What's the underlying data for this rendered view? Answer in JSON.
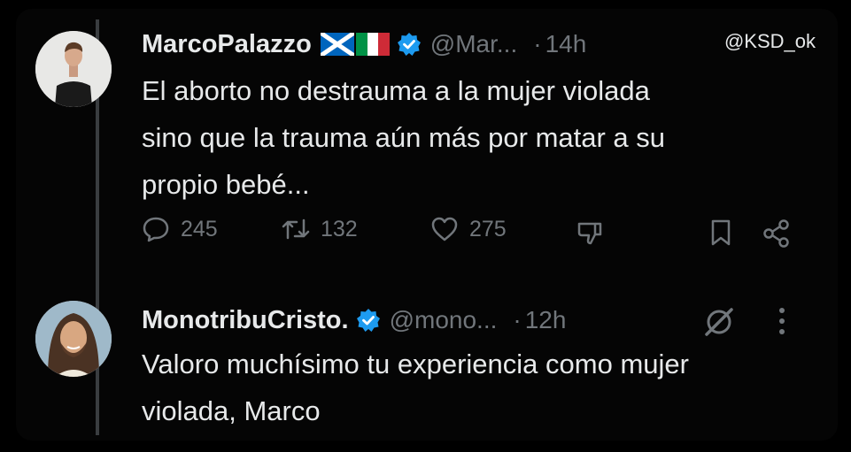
{
  "watermark": "@KSD_ok",
  "tweets": [
    {
      "name": "MarcoPalazzo",
      "handle": "@Mar...",
      "dot": "·",
      "time": "14h",
      "text_lines": [
        "El aborto no destrauma a la mujer violada",
        "sino que la trauma aún más por matar a su",
        "propio bebé..."
      ],
      "stats": {
        "replies": "245",
        "retweets": "132",
        "likes": "275"
      },
      "flags": [
        "scotland-flag",
        "italy-flag"
      ],
      "icons": [
        "reply-icon",
        "retweet-icon",
        "like-icon",
        "dislike-icon",
        "bookmark-icon",
        "share-icon"
      ]
    },
    {
      "name": "MonotribuCristo.",
      "handle": "@mono...",
      "dot": "·",
      "time": "12h",
      "text_lines": [
        "Valoro muchísimo tu experiencia como mujer",
        "violada, Marco"
      ],
      "icons": [
        "grok-icon",
        "more-options-icon"
      ]
    }
  ],
  "colors": {
    "background": "#000000",
    "text": "#e7e9ea",
    "muted": "#71767b",
    "verified": "#1d9bf0",
    "thread_line": "#3a3d40"
  }
}
